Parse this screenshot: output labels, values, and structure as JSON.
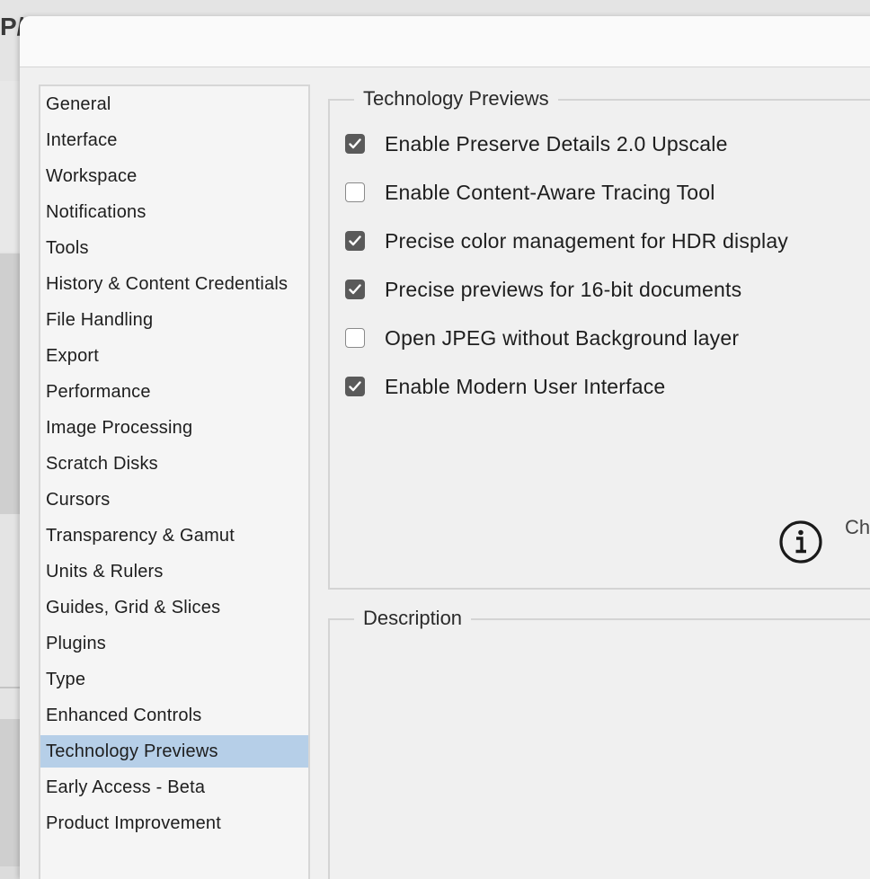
{
  "background_app": {
    "title_fragment": "P/"
  },
  "sidebar": {
    "items": [
      {
        "label": "General"
      },
      {
        "label": "Interface"
      },
      {
        "label": "Workspace"
      },
      {
        "label": "Notifications"
      },
      {
        "label": "Tools"
      },
      {
        "label": "History & Content Credentials"
      },
      {
        "label": "File Handling"
      },
      {
        "label": "Export"
      },
      {
        "label": "Performance"
      },
      {
        "label": "Image Processing"
      },
      {
        "label": "Scratch Disks"
      },
      {
        "label": "Cursors"
      },
      {
        "label": "Transparency & Gamut"
      },
      {
        "label": "Units & Rulers"
      },
      {
        "label": "Guides, Grid & Slices"
      },
      {
        "label": "Plugins"
      },
      {
        "label": "Type"
      },
      {
        "label": "Enhanced Controls"
      },
      {
        "label": "Technology Previews"
      },
      {
        "label": "Early Access - Beta"
      },
      {
        "label": "Product Improvement"
      }
    ],
    "selected": "Technology Previews",
    "selected_color": "#b6cfe8"
  },
  "tech_previews": {
    "title": "Technology Previews",
    "options": [
      {
        "label": "Enable Preserve Details 2.0 Upscale",
        "checked": true
      },
      {
        "label": "Enable Content-Aware Tracing Tool",
        "checked": false
      },
      {
        "label": "Precise color management for HDR display",
        "checked": true
      },
      {
        "label": "Precise previews for 16-bit documents",
        "checked": true
      },
      {
        "label": "Open JPEG without Background layer",
        "checked": false
      },
      {
        "label": "Enable Modern User Interface",
        "checked": true
      }
    ],
    "info_icon": "info-circle-icon",
    "info_text": "Ch"
  },
  "description": {
    "title": "Description"
  },
  "colors": {
    "checkbox_checked": "#5a5a5a",
    "dialog_bg": "#f0f0f0"
  }
}
